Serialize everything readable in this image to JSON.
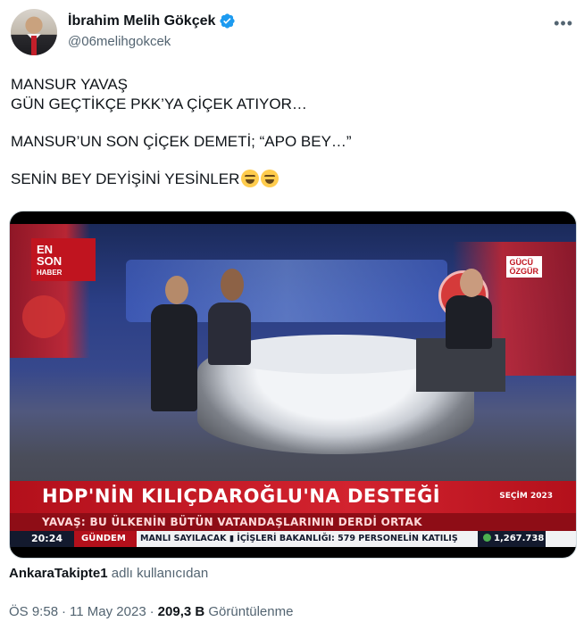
{
  "author": {
    "display_name": "İbrahim Melih Gökçek",
    "handle": "@06melihgokcek",
    "verified_icon": "verified-badge-icon",
    "accent_color": "#1d9bf0"
  },
  "tweet": {
    "lines": [
      "MANSUR YAVAŞ",
      "GÜN GEÇTİKÇE PKK’YA ÇİÇEK ATIYOR…",
      "MANSUR’UN SON ÇİÇEK DEMETİ; “APO BEY…”",
      "SENİN BEY DEYİŞİNİ YESİNLER"
    ],
    "emojis": [
      "grinning-squinting-face",
      "grinning-squinting-face"
    ]
  },
  "media": {
    "channel_logo": [
      "EN",
      "SON",
      "HABER"
    ],
    "channel_year": "2023",
    "corner_tag": [
      "GÜCÜ",
      "ÖZGÜR"
    ],
    "headline": "HDP'NİN KILIÇDAROĞLU'NA DESTEĞİ",
    "badge": "SEÇİM 2023",
    "subline": "YAVAŞ: BU ÜLKENİN BÜTÜN VATANDAŞLARININ DERDİ ORTAK",
    "time": "20:24",
    "section": "GÜNDEM",
    "ticker": "MANLI SAYILACAK  ▮  İÇİŞLERİ BAKANLIĞI: 579 PERSONELİN KATILIŞ",
    "value": "1,267.738"
  },
  "source": {
    "account": "AnkaraTakipte1",
    "suffix": " adlı kullanıcıdan"
  },
  "meta": {
    "time": "ÖS 9:58",
    "date": "11 May 2023",
    "views_count": "209,3 B",
    "views_label": "Görüntülenme"
  },
  "more_icon": "more-horizontal-icon"
}
